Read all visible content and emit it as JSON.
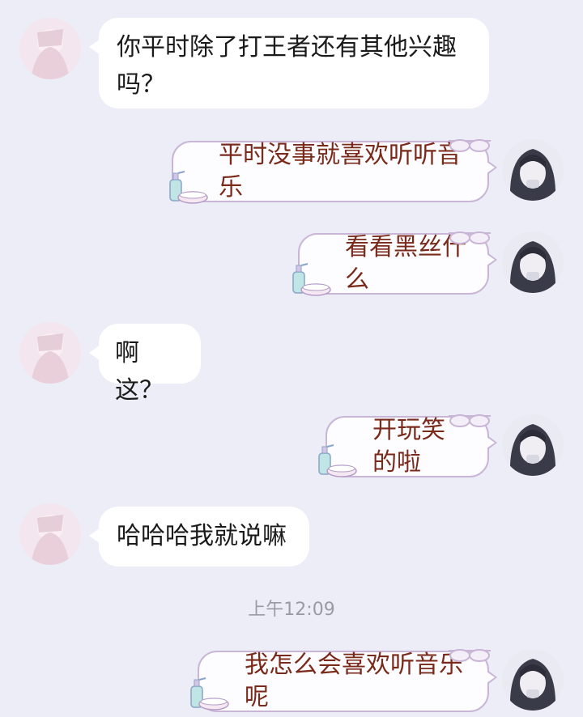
{
  "messages": [
    {
      "side": "in",
      "text_line1": "你平时除了打王者还有其他兴趣",
      "text_line2": "吗？"
    },
    {
      "side": "out",
      "text": "平时没事就喜欢听听音乐"
    },
    {
      "side": "out",
      "text": "看看黑丝什么"
    },
    {
      "side": "in",
      "text": "啊这？"
    },
    {
      "side": "out",
      "text": "开玩笑的啦"
    },
    {
      "side": "in",
      "text": "哈哈哈我就说嘛"
    },
    {
      "side": "out",
      "text": "我怎么会喜欢听音乐呢"
    }
  ],
  "timestamp": "上午12:09",
  "colors": {
    "background": "#ecedf6",
    "incoming_bubble": "#ffffff",
    "outgoing_bubble_border": "#c9b5d6",
    "outgoing_text": "#7a2a1a"
  },
  "icons": {
    "contact_avatar": "anime-girl-avatar-icon",
    "self_avatar": "dark-hair-anime-avatar-icon",
    "bubble_decoration": "soap-bottle-basin-icon"
  }
}
